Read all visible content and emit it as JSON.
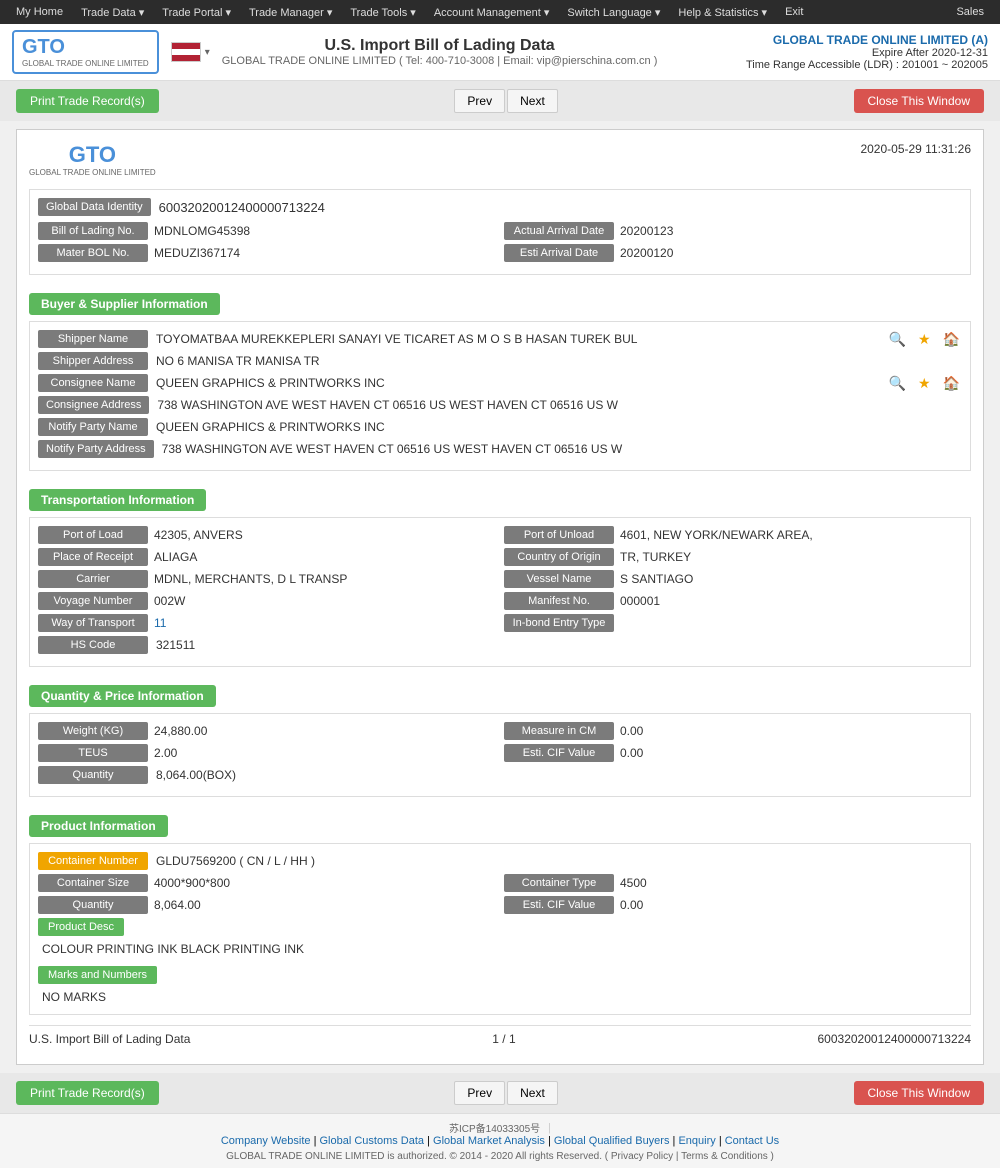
{
  "nav": {
    "items": [
      "My Home",
      "Trade Data",
      "Trade Portal",
      "Trade Manager",
      "Trade Tools",
      "Account Management",
      "Switch Language",
      "Help & Statistics",
      "Exit"
    ],
    "right": "Sales"
  },
  "header": {
    "title": "U.S. Import Bill of Lading Data",
    "company_line": "GLOBAL TRADE ONLINE LIMITED ( Tel: 400-710-3008 | Email: vip@pierschina.com.cn )",
    "account_company": "GLOBAL TRADE ONLINE LIMITED (A)",
    "expire": "Expire After 2020-12-31",
    "time_range": "Time Range Accessible (LDR) : 201001 ~ 202005"
  },
  "buttons": {
    "print": "Print Trade Record(s)",
    "prev": "Prev",
    "next": "Next",
    "close": "Close This Window"
  },
  "record": {
    "date": "2020-05-29  11:31:26",
    "global_data_id_label": "Global Data Identity",
    "global_data_id": "60032020012400000713224",
    "bol_no_label": "Bill of Lading No.",
    "bol_no": "MDNLOMG45398",
    "actual_arrival_label": "Actual Arrival Date",
    "actual_arrival": "20200123",
    "master_bol_label": "Mater BOL No.",
    "master_bol": "MEDUZI367174",
    "esti_arrival_label": "Esti Arrival Date",
    "esti_arrival": "20200120"
  },
  "buyer_supplier": {
    "section_title": "Buyer & Supplier Information",
    "shipper_name_label": "Shipper Name",
    "shipper_name": "TOYOMATBAA MUREKKEPLERI SANAYI VE TICARET AS M O S B HASAN TUREK BUL",
    "shipper_address_label": "Shipper Address",
    "shipper_address": "NO 6 MANISA TR MANISA TR",
    "consignee_name_label": "Consignee Name",
    "consignee_name": "QUEEN GRAPHICS & PRINTWORKS INC",
    "consignee_address_label": "Consignee Address",
    "consignee_address": "738 WASHINGTON AVE WEST HAVEN CT 06516 US WEST HAVEN CT 06516 US W",
    "notify_party_label": "Notify Party Name",
    "notify_party": "QUEEN GRAPHICS & PRINTWORKS INC",
    "notify_party_address_label": "Notify Party Address",
    "notify_party_address": "738 WASHINGTON AVE WEST HAVEN CT 06516 US WEST HAVEN CT 06516 US W"
  },
  "transportation": {
    "section_title": "Transportation Information",
    "port_of_load_label": "Port of Load",
    "port_of_load": "42305, ANVERS",
    "port_of_unload_label": "Port of Unload",
    "port_of_unload": "4601, NEW YORK/NEWARK AREA,",
    "place_of_receipt_label": "Place of Receipt",
    "place_of_receipt": "ALIAGA",
    "country_of_origin_label": "Country of Origin",
    "country_of_origin": "TR, TURKEY",
    "carrier_label": "Carrier",
    "carrier": "MDNL, MERCHANTS, D L TRANSP",
    "vessel_name_label": "Vessel Name",
    "vessel_name": "S SANTIAGO",
    "voyage_number_label": "Voyage Number",
    "voyage_number": "002W",
    "manifest_no_label": "Manifest No.",
    "manifest_no": "000001",
    "way_of_transport_label": "Way of Transport",
    "way_of_transport": "11",
    "inbond_entry_label": "In-bond Entry Type",
    "inbond_entry": "",
    "hs_code_label": "HS Code",
    "hs_code": "321511"
  },
  "quantity_price": {
    "section_title": "Quantity & Price Information",
    "weight_label": "Weight (KG)",
    "weight": "24,880.00",
    "measure_cm_label": "Measure in CM",
    "measure_cm": "0.00",
    "teus_label": "TEUS",
    "teus": "2.00",
    "esti_cif_label": "Esti. CIF Value",
    "esti_cif": "0.00",
    "quantity_label": "Quantity",
    "quantity": "8,064.00(BOX)"
  },
  "product_info": {
    "section_title": "Product Information",
    "container_number_label": "Container Number",
    "container_number": "GLDU7569200 ( CN / L / HH )",
    "container_size_label": "Container Size",
    "container_size": "4000*900*800",
    "container_type_label": "Container Type",
    "container_type": "4500",
    "quantity_label": "Quantity",
    "quantity": "8,064.00",
    "esti_cif_label": "Esti. CIF Value",
    "esti_cif": "0.00",
    "product_desc_label": "Product Desc",
    "product_desc": "COLOUR PRINTING INK BLACK PRINTING INK",
    "marks_label": "Marks and Numbers",
    "marks": "NO MARKS"
  },
  "footer_record": {
    "left": "U.S. Import Bill of Lading Data",
    "center": "1 / 1",
    "right": "60032020012400000713224"
  },
  "site_footer": {
    "links": [
      "Company Website",
      "Global Customs Data",
      "Global Market Analysis",
      "Global Qualified Buyers",
      "Enquiry",
      "Contact Us"
    ],
    "icp": "苏ICP备14033305号",
    "copy_text": "GLOBAL TRADE ONLINE LIMITED is authorized. © 2014 - 2020 All rights Reserved.  (  Privacy Policy  |  Terms & Conditions  )"
  }
}
